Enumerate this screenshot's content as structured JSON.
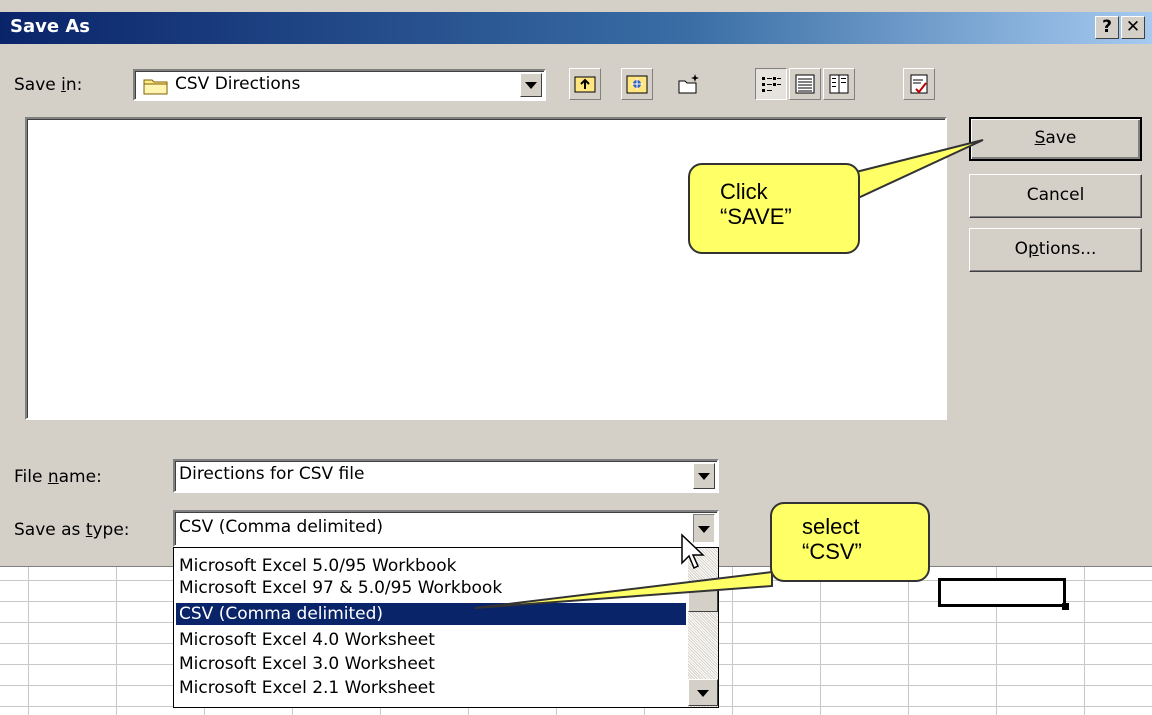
{
  "dialog": {
    "title": "Save As",
    "help_label": "?",
    "close_label": "✕"
  },
  "save_in": {
    "label_pre": "Save ",
    "label_u": "i",
    "label_post": "n:",
    "value": "CSV Directions"
  },
  "toolbar": {
    "icons": [
      "back-up-folder-icon",
      "search-web-icon",
      "new-folder-icon",
      "list-view-icon",
      "details-view-icon",
      "properties-view-icon",
      "tools-icon"
    ]
  },
  "buttons": {
    "save_u": "S",
    "save_rest": "ave",
    "cancel": "Cancel",
    "options_pre": "O",
    "options_u": "p",
    "options_post": "tions..."
  },
  "file_name": {
    "label_pre": "File ",
    "label_u": "n",
    "label_post": "ame:",
    "value": "Directions for CSV file"
  },
  "save_type": {
    "label_pre": "Save as ",
    "label_u": "t",
    "label_post": "ype:",
    "value": "CSV (Comma delimited)",
    "options": [
      "Microsoft Excel 5.0/95 Workbook",
      "Microsoft Excel 97 & 5.0/95 Workbook",
      "CSV (Comma delimited)",
      "Microsoft Excel 4.0 Worksheet",
      "Microsoft Excel 3.0 Worksheet",
      "Microsoft Excel 2.1 Worksheet"
    ],
    "selected_index": 2
  },
  "annotations": {
    "save_callout": "Click\n“SAVE”",
    "csv_callout": "select\n“CSV”"
  },
  "colors": {
    "title_bar": "#0a246a",
    "dialog_bg": "#d4d0c8",
    "selection": "#0a246a",
    "callout": "#ffff66"
  }
}
